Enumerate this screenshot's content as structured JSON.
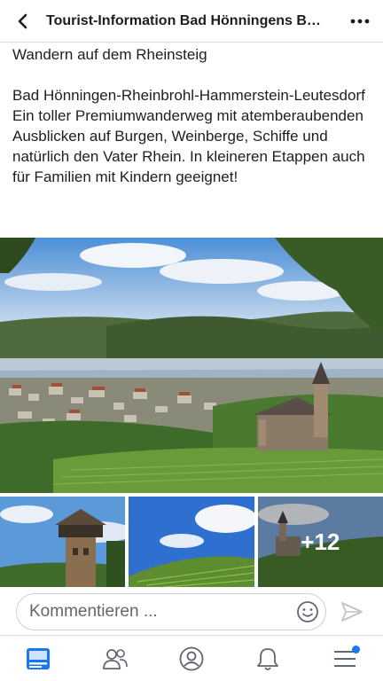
{
  "header": {
    "title": "Tourist-Information Bad Hönningens Bei...",
    "back_icon": "back-arrow-icon",
    "more_icon": "more-dots-icon"
  },
  "post": {
    "lines": [
      "Wandern auf dem Rheinsteig",
      "",
      "Bad Hönningen-Rheinbrohl-Hammerstein-Leutesdorf",
      "Ein toller Premiumwanderweg mit atemberaubenden Ausblicken auf Burgen, Weinberge, Schiffe und natürlich den Vater Rhein. In kleineren Etappen auch für Familien mit Kindern geeignet!"
    ],
    "extra_photos": "+12"
  },
  "comment": {
    "placeholder": "Kommentieren ...",
    "emoji_icon": "emoji-icon",
    "send_icon": "send-icon"
  },
  "tabbar": {
    "tabs": [
      "news-feed-icon",
      "friends-icon",
      "profile-icon",
      "notifications-icon",
      "menu-icon"
    ],
    "active": "news-feed-icon",
    "accent_color": "#1877f2"
  }
}
